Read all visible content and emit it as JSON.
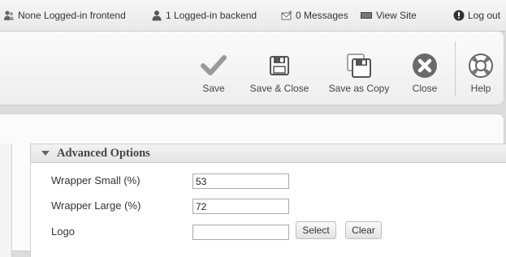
{
  "statusbar": {
    "frontend": "None Logged-in frontend",
    "backend": "1 Logged-in backend",
    "messages": "0 Messages",
    "view_site": "View Site",
    "logout": "Log out"
  },
  "toolbar": {
    "save": "Save",
    "save_close": "Save & Close",
    "save_copy": "Save as Copy",
    "close": "Close",
    "help": "Help"
  },
  "fieldset": {
    "title": "Advanced Options",
    "fields": [
      {
        "label": "Wrapper Small (%)",
        "value": "53"
      },
      {
        "label": "Wrapper Large (%)",
        "value": "72"
      },
      {
        "label": "Logo",
        "value": ""
      }
    ],
    "select_label": "Select",
    "clear_label": "Clear"
  },
  "icons": {
    "frontend": "users-icon",
    "backend": "user-icon",
    "messages": "mail-icon",
    "view_site": "screen-icon",
    "logout": "power-icon",
    "save": "checkmark-icon",
    "save_close": "floppy-icon",
    "save_copy": "floppy-copy-icon",
    "close": "close-circle-icon",
    "help": "lifebuoy-icon"
  }
}
